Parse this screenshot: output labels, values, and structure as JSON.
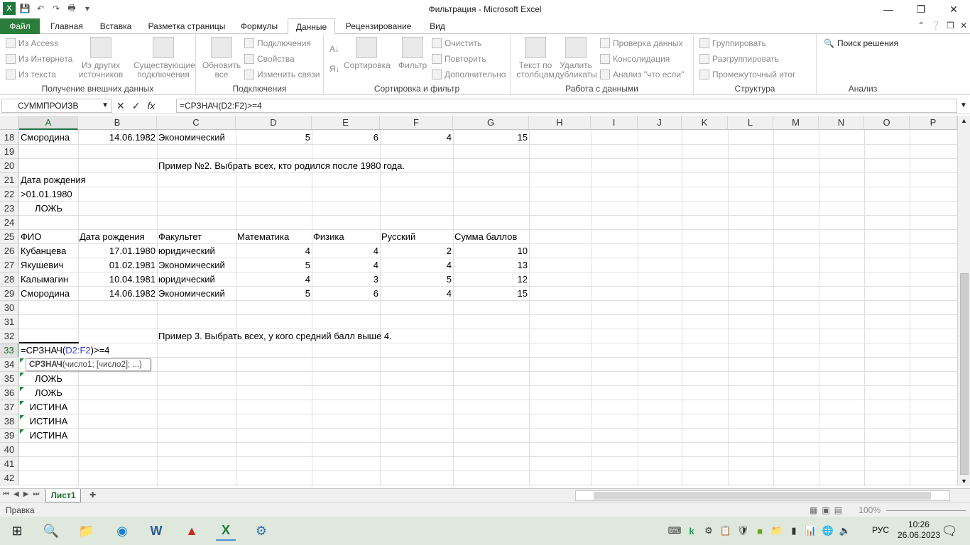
{
  "window": {
    "title": "Фильтрация  -  Microsoft Excel"
  },
  "tabs": [
    "Файл",
    "Главная",
    "Вставка",
    "Разметка страницы",
    "Формулы",
    "Данные",
    "Рецензирование",
    "Вид"
  ],
  "active_tab": "Данные",
  "ribbon": {
    "external": {
      "label": "Получение внешних данных",
      "access": "Из Access",
      "web": "Из Интернета",
      "text": "Из текста",
      "other": "Из других источников",
      "existing": "Существующие подключения"
    },
    "connections": {
      "label": "Подключения",
      "refresh": "Обновить все",
      "conn": "Подключения",
      "props": "Свойства",
      "links": "Изменить связи"
    },
    "sort": {
      "label": "Сортировка и фильтр",
      "sort": "Сортировка",
      "filter": "Фильтр",
      "clear": "Очистить",
      "reapply": "Повторить",
      "advanced": "Дополнительно"
    },
    "tools": {
      "label": "Работа с данными",
      "t2c": "Текст по столбцам",
      "dup": "Удалить дубликаты",
      "valid": "Проверка данных",
      "consol": "Консолидация",
      "whatif": "Анализ \"что если\""
    },
    "outline": {
      "label": "Структура",
      "group": "Группировать",
      "ungroup": "Разгруппировать",
      "subtotal": "Промежуточный итог"
    },
    "analysis": {
      "label": "Анализ",
      "solver": "Поиск решения"
    }
  },
  "namebox": "СУММПРОИЗВ",
  "formula": "=СРЗНАЧ(D2:F2)>=4",
  "columns": [
    "A",
    "B",
    "C",
    "D",
    "E",
    "F",
    "G",
    "H",
    "I",
    "J",
    "K",
    "L",
    "M",
    "N",
    "O",
    "P"
  ],
  "rows": [
    18,
    19,
    20,
    21,
    22,
    23,
    24,
    25,
    26,
    27,
    28,
    29,
    30,
    31,
    32,
    33,
    34,
    35,
    36,
    37,
    38,
    39,
    40,
    41,
    42
  ],
  "cells": {
    "r18": [
      "Смородина",
      "14.06.1982",
      "Экономический",
      "5",
      "6",
      "4",
      "15"
    ],
    "r20c": "Пример №2. Выбрать всех, кто родился после 1980 года.",
    "r21a": "Дата рождения",
    "r22a": ">01.01.1980",
    "r23a": "ЛОЖЬ",
    "r25": [
      "ФИО",
      "Дата рождения",
      "Факультет",
      "Математика",
      "Физика",
      "Русский",
      "Сумма баллов"
    ],
    "r26": [
      "Кубанцева",
      "17.01.1980",
      "юридический",
      "4",
      "4",
      "2",
      "10"
    ],
    "r27": [
      "Якушевич",
      "01.02.1981",
      "Экономический",
      "5",
      "4",
      "4",
      "13"
    ],
    "r28": [
      "Калымагин",
      "10.04.1981",
      "юридический",
      "4",
      "3",
      "5",
      "12"
    ],
    "r29": [
      "Смородина",
      "14.06.1982",
      "Экономический",
      "5",
      "6",
      "4",
      "15"
    ],
    "r32c": "Пример 3. Выбрать всех, у кого средний балл выше 4.",
    "r33_pre": "=СРЗНАЧ(",
    "r33_ref": "D2:F2",
    "r33_post": ")>=4",
    "r35a": "ЛОЖЬ",
    "r36a": "ЛОЖЬ",
    "r37a": "ИСТИНА",
    "r38a": "ИСТИНА",
    "r39a": "ИСТИНА"
  },
  "tooltip": {
    "func": "СРЗНАЧ",
    "args": "(число1; [число2]; ...)"
  },
  "sheet": {
    "name": "Лист1"
  },
  "status": {
    "mode": "Правка",
    "zoom": "100%"
  },
  "taskbar": {
    "lang": "РУС",
    "time": "10:26",
    "date": "26.06.2023"
  }
}
